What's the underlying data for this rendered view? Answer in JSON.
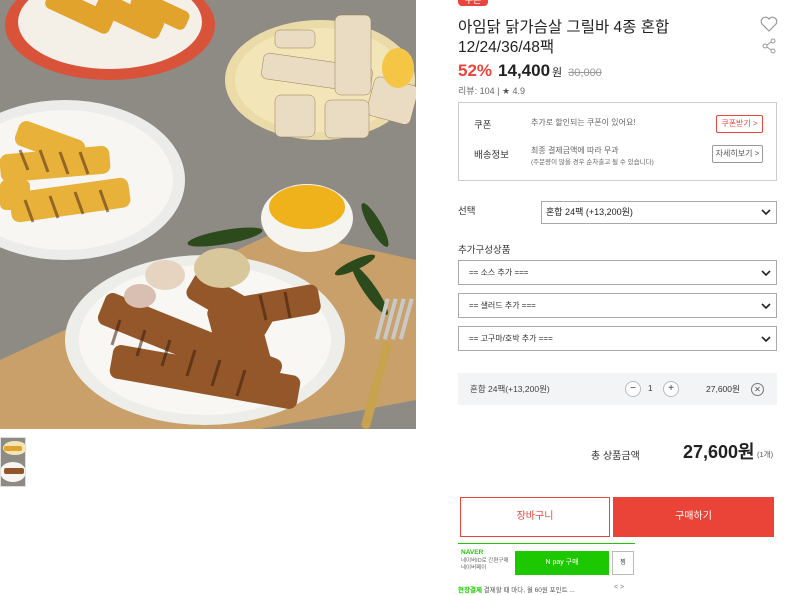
{
  "product": {
    "badge": "쿠폰",
    "title_line1": "아임닭 닭가슴살 그릴바 4종 혼합",
    "title_line2": "12/24/36/48팩",
    "discount": "52%",
    "price": "14,400",
    "price_unit": "원",
    "original_price": "30,000",
    "review_label": "리뷰",
    "review_count": "104",
    "rating": "4.9"
  },
  "info": {
    "coupon_label": "쿠폰",
    "coupon_text": "추가로 할인되는 쿠폰이 있어요!",
    "coupon_button": "쿠폰받기 >",
    "shipping_label": "배송정보",
    "shipping_line1": "최종 결제금액에 따라 무과",
    "shipping_line2": "(주문량이 많을 경우 순차출고 될 수 있습니다)",
    "detail_button": "자세히보기 >"
  },
  "options": {
    "select_label": "선택",
    "selected_value": "혼합 24팩 (+13,200원)",
    "addon_label": "추가구성상품",
    "addons": [
      "== 소스 추가 ===",
      "== 샐러드 추가 ===",
      "== 고구마/호박 추가 ==="
    ]
  },
  "selection": {
    "name": "혼합 24팩(+13,200원)",
    "minus": "−",
    "quantity": "1",
    "plus": "+",
    "price": "27,600원",
    "remove": "✕"
  },
  "total": {
    "label": "총 상품금액",
    "price": "27,600원",
    "count": "(1개)"
  },
  "actions": {
    "cart": "장바구니",
    "buy": "구매하기"
  },
  "npay": {
    "logo": "NAVER",
    "sub1": "네이버ID로 간편구매",
    "sub2": "네이버페이",
    "button": "N pay 구매",
    "button2": "찜",
    "foot_highlight": "현장결제",
    "foot_text": " 결제할 때 마다, 월 60원 포인트 ...",
    "foot_arrows": "< >"
  },
  "colors": {
    "accent": "#e8453c",
    "npay": "#1ec800"
  }
}
